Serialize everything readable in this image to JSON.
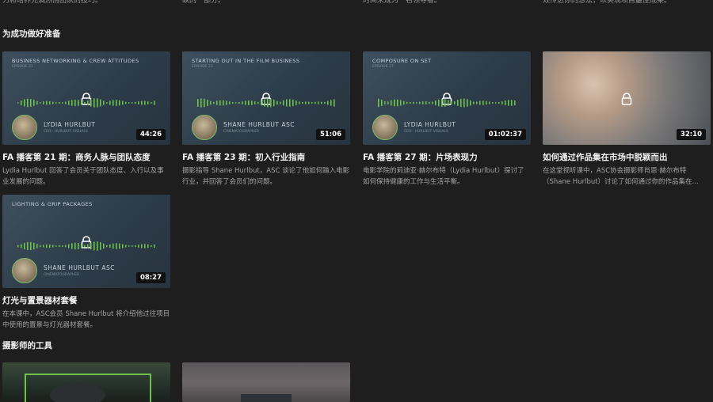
{
  "top_descriptions": [
    "力和培养充满热情团队的技巧。",
    "缺的一部分。",
    "时间来成为一名领导者。",
    "效传达你的想法，以实现项目最佳成果。"
  ],
  "sections": [
    {
      "title": "为成功做好准备"
    },
    {
      "title": "摄影师的工具"
    }
  ],
  "cards": [
    {
      "thumb_title": "BUSINESS NETWORKING & CREW ATTITUDES",
      "thumb_sub": "EPISODE 21",
      "speaker": "LYDIA HURLBUT",
      "speaker_role": "CEO · HURLBUT VISUALS",
      "duration": "44:26",
      "title": "FA 播客第 21 期：商务人脉与团队态度",
      "description": "Lydia Hurlbut 回答了会员关于团队态度、入行以及事业发展的问题。"
    },
    {
      "thumb_title": "STARTING OUT IN THE FILM BUSINESS",
      "thumb_sub": "EPISODE 23",
      "speaker": "SHANE HURLBUT ASC",
      "speaker_role": "CINEMATOGRAPHER",
      "duration": "51:06",
      "title": "FA 播客第 23 期：初入行业指南",
      "description": "摄影指导 Shane Hurlbut，ASC 谈论了他如何踏入电影行业，并回答了会员们的问题。"
    },
    {
      "thumb_title": "COMPOSURE ON SET",
      "thumb_sub": "EPISODE 27",
      "speaker": "LYDIA HURLBUT",
      "speaker_role": "CEO · HURLBUT VISUALS",
      "duration": "01:02:37",
      "title": "FA 播客第 27 期：片场表现力",
      "description": "电影学院的莉迪亚·赫尔布特（Lydia Hurlbut）探讨了如何保持健康的工作与生活平衡。"
    },
    {
      "duration": "32:10",
      "title": "如何通过作品集在市场中脱颖而出",
      "description": "在这堂视听课中，ASC协会摄影师肖恩·赫尔布特（Shane Hurlbut）讨论了如何通过你的作品集在..."
    },
    {
      "thumb_title": "LIGHTING & GRIP PACKAGES",
      "speaker": "SHANE HURLBUT ASC",
      "speaker_role": "CINEMATOGRAPHER",
      "duration": "08:27",
      "title": "灯光与置景器材套餐",
      "description": "在本课中，ASC会员 Shane Hurlbut 将介绍他过往项目中使用的置景与灯光器材套餐。"
    }
  ],
  "colors": {
    "background": "#1e1e1e",
    "accent_wave": "#6cc24a"
  }
}
